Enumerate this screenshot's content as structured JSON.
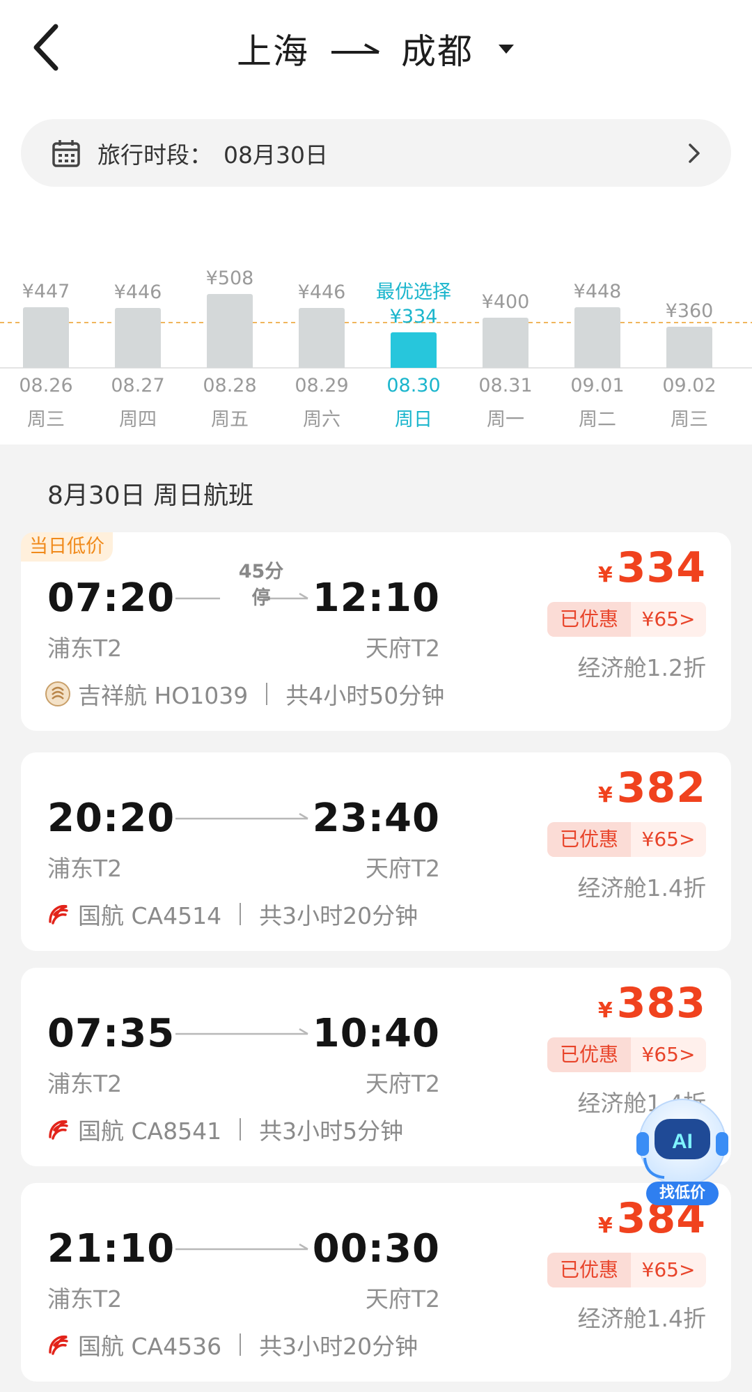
{
  "header": {
    "from_city": "上海",
    "to_city": "成都",
    "icons": [
      "back-arrow-icon",
      "route-arrow-icon",
      "caret-down-icon"
    ]
  },
  "date_pill": {
    "label": "旅行时段：",
    "value": "08月30日",
    "icons": [
      "calendar-icon",
      "chevron-right-icon"
    ]
  },
  "price_calendar": {
    "best_label": "最优选择",
    "accent": "#27c6dc",
    "bar_color": "#d4d8d9",
    "days": [
      {
        "date": "08.26",
        "weekday": "周三",
        "price": "¥447",
        "value": 447,
        "active": false
      },
      {
        "date": "08.27",
        "weekday": "周四",
        "price": "¥446",
        "value": 446,
        "active": false
      },
      {
        "date": "08.28",
        "weekday": "周五",
        "price": "¥508",
        "value": 508,
        "active": false
      },
      {
        "date": "08.29",
        "weekday": "周六",
        "price": "¥446",
        "value": 446,
        "active": false
      },
      {
        "date": "08.30",
        "weekday": "周日",
        "price": "¥334",
        "value": 334,
        "active": true
      },
      {
        "date": "08.31",
        "weekday": "周一",
        "price": "¥400",
        "value": 400,
        "active": false
      },
      {
        "date": "09.01",
        "weekday": "周二",
        "price": "¥448",
        "value": 448,
        "active": false
      },
      {
        "date": "09.02",
        "weekday": "周三",
        "price": "¥360",
        "value": 360,
        "active": false
      }
    ]
  },
  "section_title": "8月30日 周日航班",
  "flights": [
    {
      "tag": "当日低价",
      "dep_time": "07:20",
      "arr_time": "12:10",
      "dep_airport": "浦东T2",
      "arr_airport": "天府T2",
      "stop": "45分\n停",
      "airline": "吉祥航 HO1039",
      "duration": "共4小时50分钟",
      "airline_icon": "juneyao-logo-icon",
      "yen": "¥",
      "price": "334",
      "discount_label": "已优惠",
      "discount_amount": "¥65>",
      "cabin": "经济舱1.2折"
    },
    {
      "tag": "",
      "dep_time": "20:20",
      "arr_time": "23:40",
      "dep_airport": "浦东T2",
      "arr_airport": "天府T2",
      "stop": "",
      "airline": "国航 CA4514",
      "duration": "共3小时20分钟",
      "airline_icon": "air-china-logo-icon",
      "yen": "¥",
      "price": "382",
      "discount_label": "已优惠",
      "discount_amount": "¥65>",
      "cabin": "经济舱1.4折"
    },
    {
      "tag": "",
      "dep_time": "07:35",
      "arr_time": "10:40",
      "dep_airport": "浦东T2",
      "arr_airport": "天府T2",
      "stop": "",
      "airline": "国航 CA8541",
      "duration": "共3小时5分钟",
      "airline_icon": "air-china-logo-icon",
      "yen": "¥",
      "price": "383",
      "discount_label": "已优惠",
      "discount_amount": "¥65>",
      "cabin": "经济舱1.4折"
    },
    {
      "tag": "",
      "dep_time": "21:10",
      "arr_time": "00:30",
      "dep_airport": "浦东T2",
      "arr_airport": "天府T2",
      "stop": "",
      "airline": "国航 CA4536",
      "duration": "共3小时20分钟",
      "airline_icon": "air-china-logo-icon",
      "yen": "¥",
      "price": "384",
      "discount_label": "已优惠",
      "discount_amount": "¥65>",
      "cabin": "经济舱1.4折"
    }
  ],
  "ai_assistant": {
    "badge": "AI",
    "label": "找低价",
    "icon": "ai-robot-icon"
  },
  "colors": {
    "price_red": "#f0421e",
    "tag_orange": "#f08a1b",
    "accent_cyan": "#1ab5cc"
  }
}
